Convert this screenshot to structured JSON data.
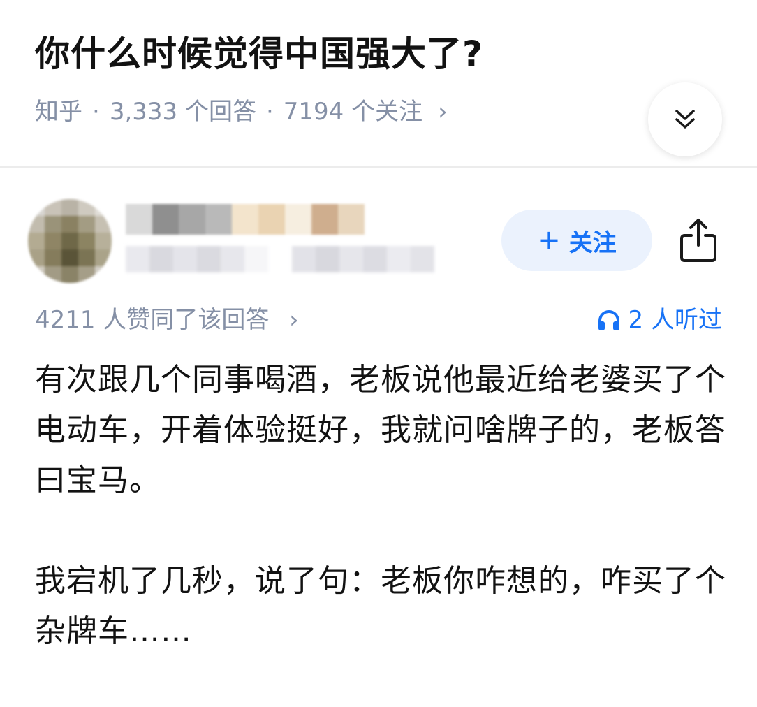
{
  "question": {
    "title": "你什么时候觉得中国强大了?",
    "source": "知乎",
    "answer_count": "3,333 个回答",
    "follower_count": "7194 个关注",
    "dot": "·",
    "chevron": "›"
  },
  "author": {
    "follow_label": "关注",
    "plus": "+"
  },
  "answer": {
    "upvote_text": "4211 人赞同了该回答",
    "chevron": "›",
    "listeners_text": "2 人听过",
    "paragraphs": [
      "有次跟几个同事喝酒，老板说他最近给老婆买了个电动车，开着体验挺好，我就问啥牌子的，老板答曰宝马。",
      "我宕机了几秒，说了句：老板你咋想的，咋买了个杂牌车……"
    ]
  },
  "colors": {
    "accent": "#1772f6",
    "meta_gray": "#8590a6",
    "follow_bg": "#ebf2fd"
  },
  "icons": {
    "collapse": "double-chevron-down-icon",
    "share": "share-icon",
    "listen": "headphones-icon"
  }
}
